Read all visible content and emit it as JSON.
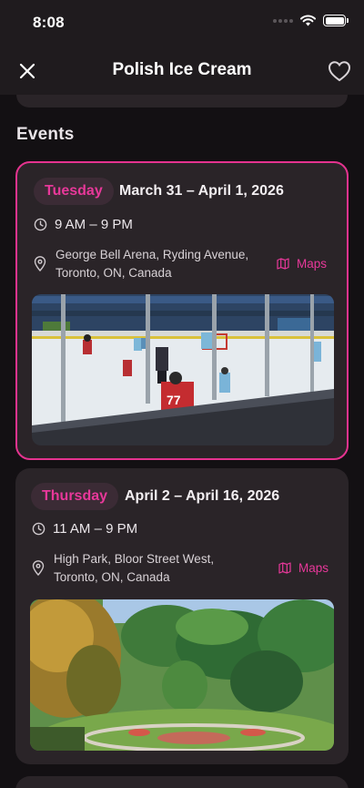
{
  "status_bar": {
    "time": "8:08"
  },
  "nav": {
    "title": "Polish Ice Cream"
  },
  "events_section": {
    "title": "Events"
  },
  "events": [
    {
      "day": "Tuesday",
      "date_range": "March 31 – April 1, 2026",
      "time": "9 AM – 9 PM",
      "location_line1": "George Bell Arena, Ryding Avenue,",
      "location_line2": "Toronto, ON, Canada",
      "maps_label": "Maps",
      "photo": "ice-hockey-rink-photo",
      "selected": true
    },
    {
      "day": "Thursday",
      "date_range": "April 2 – April 16, 2026",
      "time": "11 AM – 9 PM",
      "location_line1": "High Park, Bloor Street West,",
      "location_line2": "Toronto, ON, Canada",
      "maps_label": "Maps",
      "photo": "park-garden-photo",
      "selected": false
    }
  ],
  "colors": {
    "accent": "#e5338f",
    "background": "#131013",
    "card": "#2a2428",
    "chip": "#3b2b35"
  }
}
